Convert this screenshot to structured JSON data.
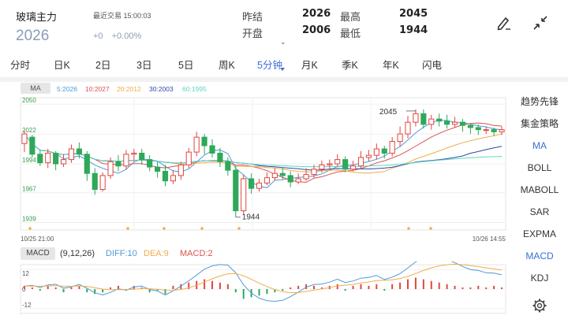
{
  "header": {
    "instrument": "玻璃主力",
    "last_trade": "最近交易 15:00:03",
    "price": "2026",
    "change": "+0",
    "change_pct": "+0.00%",
    "quotes": {
      "prev_close_label": "昨结",
      "prev_close": "2026",
      "open_label": "开盘",
      "open": "2006",
      "high_label": "最高",
      "high": "2045",
      "low_label": "最低",
      "low": "1944"
    },
    "collapse_caret": "⌄",
    "tools": [
      "pen-icon",
      "collapse-arrows-icon"
    ]
  },
  "tabs": [
    {
      "label": "分时"
    },
    {
      "label": "日K"
    },
    {
      "label": "2日"
    },
    {
      "label": "3日"
    },
    {
      "label": "5日"
    },
    {
      "label": "周K"
    },
    {
      "label": "5分钟",
      "active": true
    },
    {
      "label": "月K"
    },
    {
      "label": "季K"
    },
    {
      "label": "年K"
    },
    {
      "label": "闪电"
    }
  ],
  "ma_legend": {
    "label": "MA",
    "items": [
      {
        "text": "5:2026",
        "color": "#4e9bd6"
      },
      {
        "text": "10:2027",
        "color": "#d9534f"
      },
      {
        "text": "20:2012",
        "color": "#f0ad4e"
      },
      {
        "text": "30:2003",
        "color": "#2b4aa8"
      },
      {
        "text": "60:1995",
        "color": "#5bd6c2"
      }
    ]
  },
  "macd_legend": {
    "label": "MACD",
    "params": "(9,12,26)",
    "diff": "DIFF:10",
    "dea": "DEA:9",
    "macd": "MACD:2",
    "colors": {
      "diff": "#4e9bd6",
      "dea": "#f0ad4e",
      "macd": "#d9534f"
    }
  },
  "sidebar": [
    {
      "label": "趋势先锋"
    },
    {
      "label": "集金策略"
    },
    {
      "label": "MA",
      "active": true
    },
    {
      "label": "BOLL"
    },
    {
      "label": "MABOLL"
    },
    {
      "label": "SAR"
    },
    {
      "label": "EXPMA"
    },
    {
      "label": "MACD",
      "active": true
    },
    {
      "label": "KDJ"
    }
  ],
  "chart_data": [
    {
      "type": "candlestick",
      "title": "",
      "y_ticks": [
        "2050",
        "2022",
        "1994",
        "1967",
        "1939"
      ],
      "ylim": [
        1932,
        2056
      ],
      "x_start_label": "10/25 21:00",
      "x_end_label": "10/26 14:55",
      "annotations": [
        {
          "text": "2045",
          "index": 50,
          "value": 2045
        },
        {
          "text": "1944",
          "index": 27,
          "value": 1944
        }
      ],
      "up_color": "#e2463f",
      "down_color": "#2fa85a",
      "candles": [
        [
          2013,
          2022,
          2025,
          2005
        ],
        [
          2019,
          2003,
          2021,
          2000
        ],
        [
          2003,
          1995,
          2007,
          1992
        ],
        [
          1995,
          2004,
          2008,
          1990
        ],
        [
          2004,
          1994,
          2006,
          1988
        ],
        [
          1994,
          1998,
          2003,
          1991
        ],
        [
          1998,
          2008,
          2012,
          1995
        ],
        [
          2008,
          2003,
          2014,
          1999
        ],
        [
          2003,
          1985,
          2006,
          1978
        ],
        [
          1985,
          1970,
          1990,
          1965
        ],
        [
          1970,
          1983,
          1986,
          1968
        ],
        [
          1983,
          1996,
          2000,
          1980
        ],
        [
          1996,
          1992,
          2002,
          1987
        ],
        [
          1992,
          2003,
          2007,
          1989
        ],
        [
          2003,
          2004,
          2008,
          1996
        ],
        [
          2004,
          1998,
          2008,
          1993
        ],
        [
          1998,
          1991,
          2002,
          1987
        ],
        [
          1991,
          1987,
          1996,
          1981
        ],
        [
          1987,
          1978,
          1993,
          1973
        ],
        [
          1978,
          1983,
          1988,
          1975
        ],
        [
          1983,
          1993,
          1996,
          1979
        ],
        [
          1993,
          2005,
          2009,
          1990
        ],
        [
          2005,
          2019,
          2024,
          2001
        ],
        [
          2019,
          2011,
          2022,
          2003
        ],
        [
          2011,
          2004,
          2017,
          2000
        ],
        [
          2004,
          1996,
          2009,
          1991
        ],
        [
          1996,
          1988,
          2000,
          1983
        ],
        [
          1988,
          1950,
          1992,
          1944
        ],
        [
          1950,
          1980,
          1984,
          1947
        ],
        [
          1980,
          1971,
          1985,
          1966
        ],
        [
          1971,
          1976,
          1980,
          1968
        ],
        [
          1976,
          1981,
          1986,
          1974
        ],
        [
          1981,
          1985,
          1990,
          1978
        ],
        [
          1985,
          1983,
          1990,
          1979
        ],
        [
          1983,
          1977,
          1987,
          1972
        ],
        [
          1977,
          1980,
          1985,
          1975
        ],
        [
          1980,
          1984,
          1990,
          1978
        ],
        [
          1984,
          1989,
          1993,
          1981
        ],
        [
          1989,
          1993,
          1997,
          1986
        ],
        [
          1993,
          1994,
          1998,
          1988
        ],
        [
          1994,
          1998,
          2003,
          1991
        ],
        [
          1998,
          1989,
          2001,
          1986
        ],
        [
          1989,
          1992,
          1997,
          1987
        ],
        [
          1992,
          2000,
          2006,
          1990
        ],
        [
          2000,
          2002,
          2007,
          1996
        ],
        [
          2002,
          2008,
          2013,
          1998
        ],
        [
          2008,
          2004,
          2011,
          1999
        ],
        [
          2004,
          2015,
          2019,
          2001
        ],
        [
          2015,
          2022,
          2029,
          2010
        ],
        [
          2022,
          2033,
          2039,
          2018
        ],
        [
          2033,
          2041,
          2045,
          2029
        ],
        [
          2041,
          2031,
          2045,
          2027
        ],
        [
          2031,
          2036,
          2040,
          2026
        ],
        [
          2036,
          2034,
          2041,
          2029
        ],
        [
          2034,
          2031,
          2040,
          2027
        ],
        [
          2031,
          2033,
          2038,
          2028
        ],
        [
          2033,
          2030,
          2036,
          2024
        ],
        [
          2030,
          2028,
          2032,
          2022
        ],
        [
          2028,
          2026,
          2031,
          2021
        ],
        [
          2026,
          2026,
          2029,
          2022
        ],
        [
          2026,
          2024,
          2028,
          2020
        ],
        [
          2024,
          2026,
          2029,
          2021
        ]
      ]
    },
    {
      "type": "macd",
      "y_ticks": [
        "12",
        "0",
        "-12"
      ],
      "ylim": [
        -15,
        15
      ],
      "histogram": [
        2,
        1,
        -1,
        2,
        1,
        -2,
        1,
        2,
        -2,
        -3,
        -2,
        1,
        2,
        -1,
        2,
        1,
        -2,
        -1,
        -3,
        2,
        3,
        4,
        5,
        6,
        5,
        4,
        3,
        -2,
        -6,
        -5,
        -4,
        -3,
        -2,
        -1,
        1,
        2,
        3,
        2,
        1,
        2,
        3,
        -1,
        2,
        3,
        2,
        3,
        -1,
        3,
        4,
        6,
        7,
        6,
        5,
        4,
        3,
        2,
        1,
        1,
        2,
        1,
        2,
        1
      ]
    }
  ]
}
